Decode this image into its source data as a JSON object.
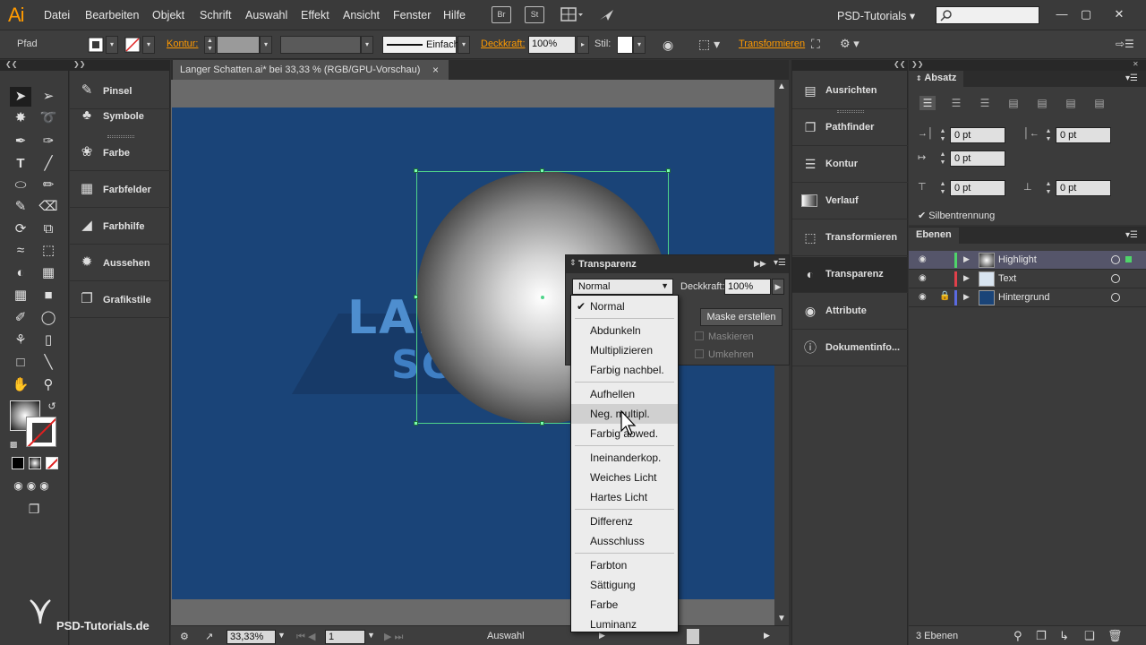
{
  "app": {
    "logo": "Ai",
    "workspace": "PSD-Tutorials"
  },
  "menu": [
    "Datei",
    "Bearbeiten",
    "Objekt",
    "Schrift",
    "Auswahl",
    "Effekt",
    "Ansicht",
    "Fenster",
    "Hilfe"
  ],
  "menubar_icons": {
    "br": "Br",
    "st": "St"
  },
  "control_bar": {
    "object_type": "Pfad",
    "stroke_label": "Kontur:",
    "stroke_profile": "Einfach",
    "opacity_label": "Deckkraft:",
    "opacity_value": "100%",
    "style_label": "Stil:",
    "transform_link": "Transformieren"
  },
  "document": {
    "tab_title": "Langer Schatten.ai* bei 33,33 % (RGB/GPU-Vorschau)",
    "close": "×",
    "art_text_line1": "LANG",
    "art_text_line2": "SCH"
  },
  "left_dock": [
    {
      "label": "Pinsel",
      "icon": "brush-icon"
    },
    {
      "label": "Symbole",
      "icon": "symbol-icon"
    },
    {
      "label": "Farbe",
      "icon": "palette-icon"
    },
    {
      "label": "Farbfelder",
      "icon": "swatches-icon"
    },
    {
      "label": "Farbhilfe",
      "icon": "color-guide-icon"
    },
    {
      "label": "Aussehen",
      "icon": "appearance-icon"
    },
    {
      "label": "Grafikstile",
      "icon": "graphic-styles-icon"
    }
  ],
  "middle_dock": [
    {
      "label": "Ausrichten",
      "icon": "align-icon"
    },
    {
      "label": "Pathfinder",
      "icon": "pathfinder-icon"
    },
    {
      "label": "Kontur",
      "icon": "stroke-icon"
    },
    {
      "label": "Verlauf",
      "icon": "gradient-icon"
    },
    {
      "label": "Transformieren",
      "icon": "transform-icon"
    },
    {
      "label": "Transparenz",
      "icon": "transparency-icon"
    },
    {
      "label": "Attribute",
      "icon": "attributes-icon"
    },
    {
      "label": "Dokumentinfo...",
      "icon": "document-info-icon"
    }
  ],
  "transparency_panel": {
    "title": "Transparenz",
    "blend_mode": "Normal",
    "opacity_label": "Deckkraft:",
    "opacity_value": "100%",
    "mask_button": "Maske erstellen",
    "clip_label": "Maskieren",
    "invert_label": "Umkehren"
  },
  "blend_menu": {
    "checked": "Normal",
    "hovered": "Neg. multipl.",
    "groups": [
      [
        "Normal"
      ],
      [
        "Abdunkeln",
        "Multiplizieren",
        "Farbig nachbel."
      ],
      [
        "Aufhellen",
        "Neg. multipl.",
        "Farbig abwed."
      ],
      [
        "Ineinanderkop.",
        "Weiches Licht",
        "Hartes Licht"
      ],
      [
        "Differenz",
        "Ausschluss"
      ],
      [
        "Farbton",
        "Sättigung",
        "Farbe",
        "Luminanz"
      ]
    ]
  },
  "absatz_panel": {
    "title": "Absatz",
    "left_indent": "0 pt",
    "right_indent": "0 pt",
    "first_line_indent": "0 pt",
    "space_before": "0 pt",
    "space_after": "0 pt",
    "hyphenation_label": "Silbentrennung",
    "hyphenation_checked": true
  },
  "ebenen_panel": {
    "title": "Ebenen",
    "layers": [
      {
        "name": "Highlight",
        "color": "#4fd46a",
        "selected": true,
        "locked": false
      },
      {
        "name": "Text",
        "color": "#e0404a",
        "selected": false,
        "locked": false
      },
      {
        "name": "Hintergrund",
        "color": "#5a6ae0",
        "selected": false,
        "locked": true
      }
    ],
    "count": "3 Ebenen"
  },
  "status_bar": {
    "zoom": "33,33%",
    "artboard": "1",
    "tool": "Auswahl"
  },
  "watermark": "PSD-Tutorials.de",
  "colors": {
    "artboard": "#1a4478",
    "accent_orange": "#ff9a00",
    "selection": "#4fd48a"
  }
}
